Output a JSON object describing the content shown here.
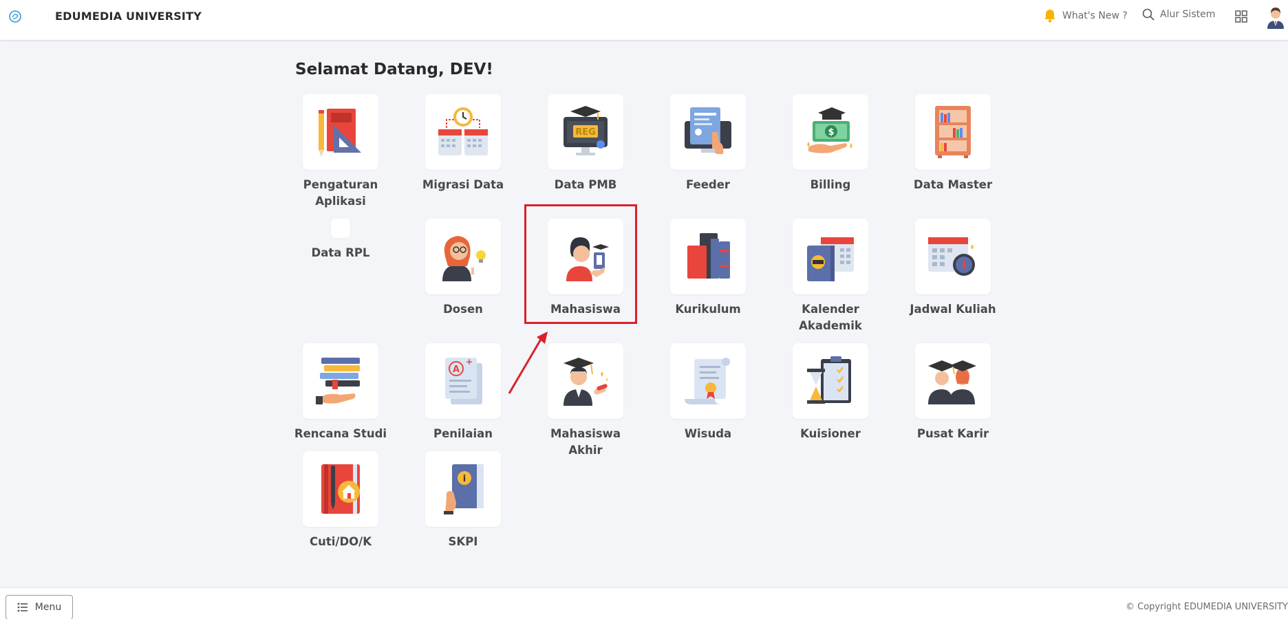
{
  "header": {
    "brand_title": "EDUMEDIA UNIVERSITY",
    "whats_new_label": "What's New ?",
    "alur_sistem_label": "Alur Sistem"
  },
  "main": {
    "welcome": "Selamat Datang, DEV!",
    "tiles": [
      {
        "label": "Pengaturan Aplikasi",
        "icon": "ruler-pencil-book-icon"
      },
      {
        "label": "Migrasi Data",
        "icon": "calendar-clock-icon"
      },
      {
        "label": "Data PMB",
        "icon": "reg-monitor-icon"
      },
      {
        "label": "Feeder",
        "icon": "document-hand-icon"
      },
      {
        "label": "Billing",
        "icon": "money-graduation-icon"
      },
      {
        "label": "Data Master",
        "icon": "bookshelf-icon"
      },
      {
        "label": "Data RPL",
        "icon": "blank-icon"
      },
      {
        "label": "Dosen",
        "icon": "teacher-icon"
      },
      {
        "label": "Mahasiswa",
        "icon": "student-icon"
      },
      {
        "label": "Kurikulum",
        "icon": "books-icon"
      },
      {
        "label": "Kalender Akademik",
        "icon": "calendar-book-icon"
      },
      {
        "label": "Jadwal Kuliah",
        "icon": "calendar-compass-icon"
      },
      {
        "label": "Rencana Studi",
        "icon": "stacked-books-icon"
      },
      {
        "label": "Penilaian",
        "icon": "grade-paper-icon"
      },
      {
        "label": "Mahasiswa Akhir",
        "icon": "graduate-diploma-icon"
      },
      {
        "label": "Wisuda",
        "icon": "scroll-certificate-icon"
      },
      {
        "label": "Kuisioner",
        "icon": "hourglass-checklist-icon"
      },
      {
        "label": "Pusat Karir",
        "icon": "graduates-group-icon"
      },
      {
        "label": "Cuti/DO/K",
        "icon": "notebook-home-icon"
      },
      {
        "label": "SKPI",
        "icon": "info-book-icon"
      }
    ]
  },
  "footer": {
    "menu_label": "Menu",
    "copyright": "© Copyright EDUMEDIA UNIVERSITY"
  },
  "colors": {
    "background": "#f3f5f8",
    "highlight": "#d9202a"
  }
}
